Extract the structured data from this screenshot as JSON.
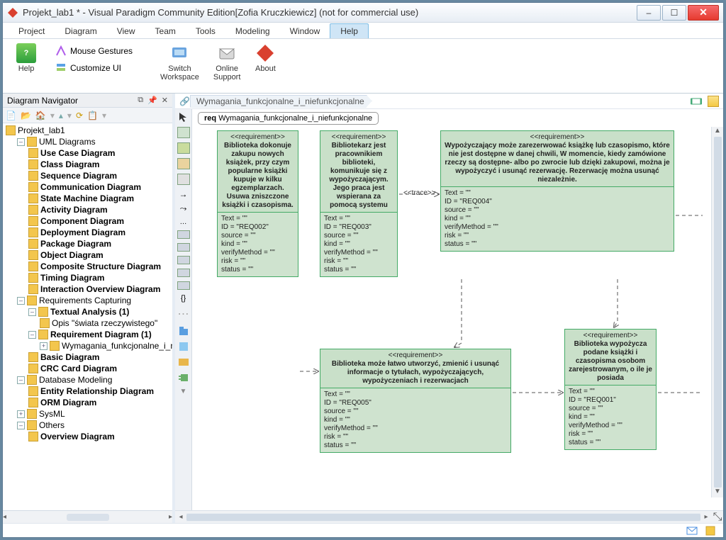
{
  "window": {
    "title": "Projekt_lab1 * - Visual Paradigm Community Edition[Zofia Kruczkiewicz] (not for commercial use)"
  },
  "menu": [
    "Project",
    "Diagram",
    "View",
    "Team",
    "Tools",
    "Modeling",
    "Window",
    "Help"
  ],
  "menu_selected_index": 7,
  "ribbon": {
    "help": "Help",
    "mouse_gestures": "Mouse Gestures",
    "customize_ui": "Customize UI",
    "switch_workspace_l1": "Switch",
    "switch_workspace_l2": "Workspace",
    "online_support_l1": "Online",
    "online_support_l2": "Support",
    "about": "About"
  },
  "navigator": {
    "title": "Diagram Navigator",
    "root": "Projekt_lab1",
    "groups": {
      "uml": {
        "label": "UML Diagrams",
        "items": [
          "Use Case Diagram",
          "Class Diagram",
          "Sequence Diagram",
          "Communication Diagram",
          "State Machine Diagram",
          "Activity Diagram",
          "Component Diagram",
          "Deployment Diagram",
          "Package Diagram",
          "Object Diagram",
          "Composite Structure Diagram",
          "Timing Diagram",
          "Interaction Overview Diagram"
        ]
      },
      "req": {
        "label": "Requirements Capturing",
        "textual_analysis": "Textual Analysis (1)",
        "textual_child": "Opis \"świata rzeczywistego\"",
        "requirement_diagram": "Requirement Diagram (1)",
        "requirement_child": "Wymagania_funkcjonalne_i_niefunkcjonalne",
        "basic_diagram": "Basic Diagram",
        "crc_card": "CRC Card Diagram"
      },
      "db": {
        "label": "Database Modeling",
        "items": [
          "Entity Relationship Diagram",
          "ORM Diagram"
        ]
      },
      "sysml": {
        "label": "SysML"
      },
      "others": {
        "label": "Others",
        "items": [
          "Overview Diagram"
        ]
      }
    }
  },
  "breadcrumb": {
    "item": "Wymagania_funkcjonalne_i_niefunkcjonalne"
  },
  "diagram": {
    "tab_prefix": "req ",
    "tab_name": "Wymagania_funkcjonalne_i_niefunkcjonalne",
    "trace_label": "<<trace>>"
  },
  "reqs": {
    "r2": {
      "stereo": "<<requirement>>",
      "title": "Biblioteka dokonuje zakupu nowych książek, przy czym popularne książki kupuje w kilku egzemplarzach. Usuwa zniszczone książki i czasopisma.",
      "props": [
        "Text = \"\"",
        "ID = \"REQ002\"",
        "source = \"\"",
        "kind = \"\"",
        "verifyMethod = \"\"",
        "risk = \"\"",
        "status = \"\""
      ]
    },
    "r3": {
      "stereo": "<<requirement>>",
      "title": "Bibliotekarz jest pracownikiem biblioteki, komunikuje się z wypożyczającym. Jego praca jest wspierana za pomocą systemu",
      "props": [
        "Text = \"\"",
        "ID = \"REQ003\"",
        "source = \"\"",
        "kind = \"\"",
        "verifyMethod = \"\"",
        "risk = \"\"",
        "status = \"\""
      ]
    },
    "r4": {
      "stereo": "<<requirement>>",
      "title": "Wypożyczający może zarezerwować książkę lub czasopismo, które nie jest dostępne w danej chwili, W momencie, kiedy zamówione rzeczy są dostępne- albo po zwrocie lub dzięki zakupowi, można je wypożyczyć i usunąć rezerwację. Rezerwację można usunąć niezależnie.",
      "props": [
        "Text = \"\"",
        "ID = \"REQ004\"",
        "source = \"\"",
        "kind = \"\"",
        "verifyMethod = \"\"",
        "risk = \"\"",
        "status = \"\""
      ]
    },
    "r5": {
      "stereo": "<<requirement>>",
      "title": "Biblioteka może łatwo utworzyć, zmienić i usunąć informacje o tytułach, wypożyczających, wypożyczeniach i rezerwacjach",
      "props": [
        "Text = \"\"",
        "ID = \"REQ005\"",
        "source = \"\"",
        "kind = \"\"",
        "verifyMethod = \"\"",
        "risk = \"\"",
        "status = \"\""
      ]
    },
    "r1": {
      "stereo": "<<requirement>>",
      "title": "Biblioteka wypożycza podane książki i czasopisma osobom zarejestrowanym, o ile je posiada",
      "props": [
        "Text = \"\"",
        "ID = \"REQ001\"",
        "source = \"\"",
        "kind = \"\"",
        "verifyMethod = \"\"",
        "risk = \"\"",
        "status = \"\""
      ]
    }
  }
}
